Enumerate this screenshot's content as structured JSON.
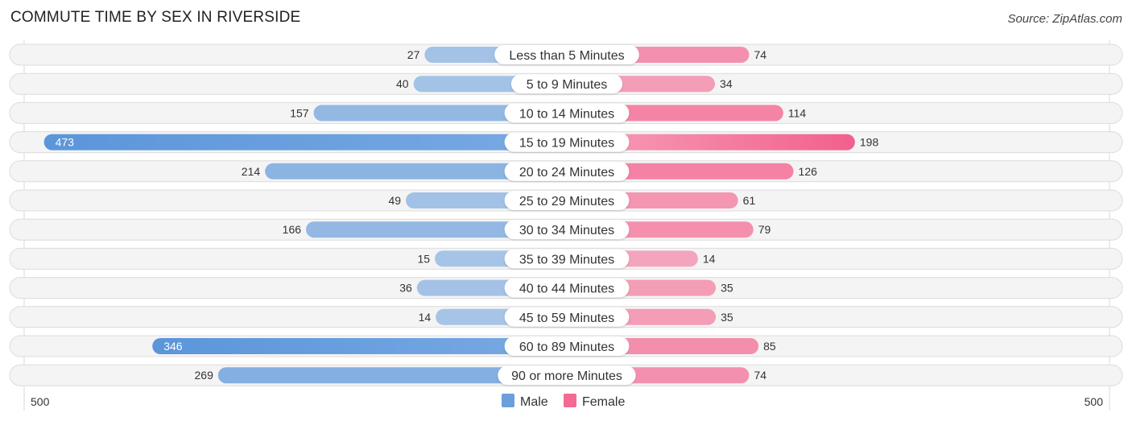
{
  "header": {
    "title": "COMMUTE TIME BY SEX IN RIVERSIDE",
    "source": "Source: ZipAtlas.com"
  },
  "chart_data": {
    "type": "bar",
    "orientation": "horizontal-diverging",
    "title": "COMMUTE TIME BY SEX IN RIVERSIDE",
    "categories": [
      "Less than 5 Minutes",
      "5 to 9 Minutes",
      "10 to 14 Minutes",
      "15 to 19 Minutes",
      "20 to 24 Minutes",
      "25 to 29 Minutes",
      "30 to 34 Minutes",
      "35 to 39 Minutes",
      "40 to 44 Minutes",
      "45 to 59 Minutes",
      "60 to 89 Minutes",
      "90 or more Minutes"
    ],
    "series": [
      {
        "name": "Male",
        "color": "#6a9fdc",
        "values": [
          27,
          40,
          157,
          473,
          214,
          49,
          166,
          15,
          36,
          14,
          346,
          269
        ]
      },
      {
        "name": "Female",
        "color": "#f46a94",
        "values": [
          74,
          34,
          114,
          198,
          126,
          61,
          79,
          14,
          35,
          35,
          85,
          74
        ]
      }
    ],
    "axis": {
      "left_label": "500",
      "right_label": "500",
      "range": [
        -500,
        500
      ]
    },
    "legend": {
      "position": "bottom-center",
      "items": [
        "Male",
        "Female"
      ]
    },
    "grid": false
  }
}
